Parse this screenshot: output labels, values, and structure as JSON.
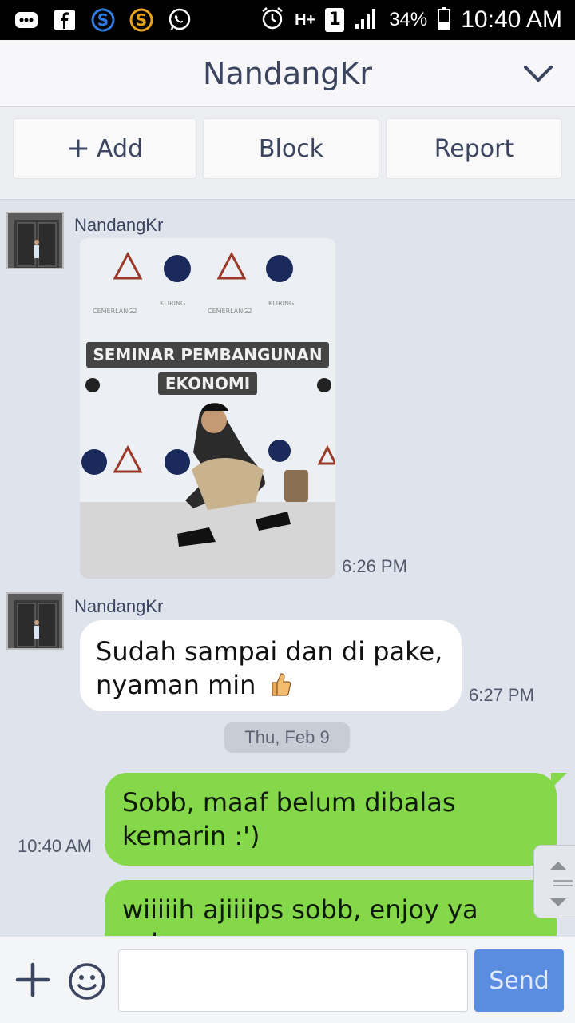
{
  "status_bar": {
    "left_icons": [
      "bbm-icon",
      "facebook-icon",
      "skype-icon",
      "s-app-icon",
      "whatsapp-icon"
    ],
    "network": "H+",
    "sim": "1",
    "battery": "34%",
    "time": "10:40 AM"
  },
  "header": {
    "title": "NandangKr"
  },
  "actions": {
    "add_label": "Add",
    "block_label": "Block",
    "report_label": "Report"
  },
  "messages": [
    {
      "sender": "NandangKr",
      "type": "photo",
      "time": "6:26 PM"
    },
    {
      "sender": "NandangKr",
      "type": "text",
      "line1": "Sudah sampai dan di pake,",
      "line2": "nyaman min",
      "emoji": "thumbs-up-icon",
      "time": "6:27 PM"
    }
  ],
  "date_divider": "Thu, Feb 9",
  "outgoing": [
    {
      "line1": "Sobb, maaf belum dibalas",
      "line2": "kemarin :')",
      "time": "10:40 AM"
    },
    {
      "line1": "wiiiiih ajiiiips sobb, enjoy ya sob,"
    }
  ],
  "photo_caption": {
    "banner_line1": "SEMINAR PEMBANGUNAN",
    "banner_line2": "EKONOMI"
  },
  "input": {
    "value": "",
    "send_label": "Send"
  },
  "colors": {
    "outgoing_bubble": "#84d84a",
    "send_button": "#5a8de0",
    "chat_bg": "#dfe4ec"
  }
}
